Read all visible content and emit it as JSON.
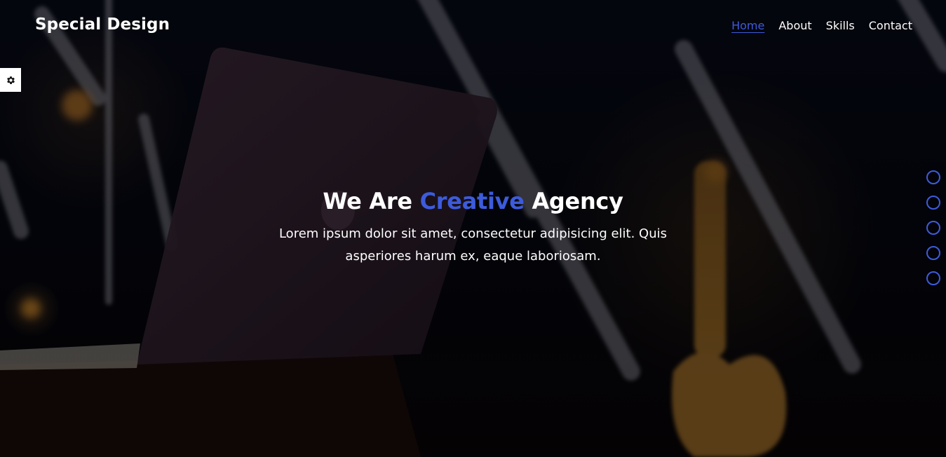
{
  "header": {
    "logo": "Special Design",
    "nav": [
      {
        "label": "Home",
        "active": true
      },
      {
        "label": "About",
        "active": false
      },
      {
        "label": "Skills",
        "active": false
      },
      {
        "label": "Contact",
        "active": false
      }
    ]
  },
  "intro": {
    "title_before": "We Are ",
    "title_accent": "Creative",
    "title_after": " Agency",
    "text": "Lorem ipsum dolor sit amet, consectetur adipisicing elit. Quis asperiores harum ex, eaque laboriosam."
  },
  "settings": {
    "icon": "gear-icon"
  },
  "bullets_count": 5,
  "colors": {
    "accent": "#3d5bdb",
    "text": "#ffffff",
    "background": "#05060d"
  }
}
